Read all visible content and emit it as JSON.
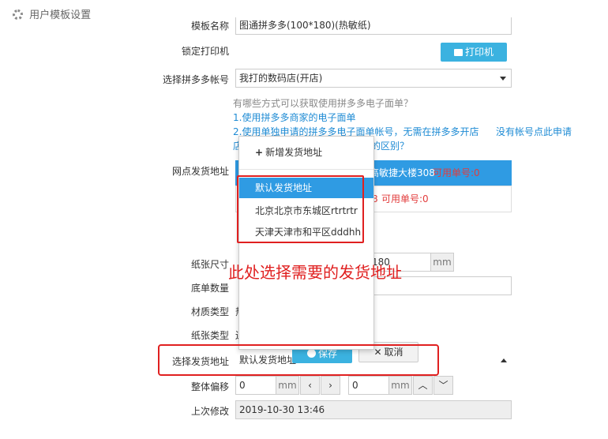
{
  "header": {
    "title": "用户模板设置"
  },
  "form": {
    "template_name_value": "图通拼多多(100*180)(热敏纸)",
    "lock_printer_label": "锁定打印机",
    "printer_button_label": "打印机",
    "pdd_account_label": "选择拼多多帐号",
    "pdd_account_value": "我打的数码店(开店)",
    "help_question": "有哪些方式可以获取使用拼多多电子面单？",
    "help_link1": "1.使用拼多多商家的电子面单",
    "help_link2": "2.使用单独申请的拼多多电子面单帐号，无需在拼多多开店",
    "help_link2_cont": "店",
    "help_link3": "没有帐号点此申请",
    "help_diff": "的区别？",
    "branch_address_label": "网点发货地址",
    "branch_row1_addr": "高敏捷大楼308",
    "branch_row1_avail": "可用单号:0",
    "branch_row2_addr": "8",
    "branch_row2_avail": "可用单号:0",
    "paper_size_label": "纸张尺寸",
    "paper_height_value": "180",
    "paper_unit": "mm",
    "base_count_label": "底单数量",
    "material_label": "材质类型",
    "material_value_fragment": "热",
    "paper_type_label": "纸张类型",
    "paper_type_fragment": "连",
    "ship_address_label": "选择发货地址",
    "ship_address_value": "默认发货地址",
    "save_button": "保存",
    "cancel_button": "取消",
    "offset_label": "整体偏移",
    "offset_x_value": "0",
    "offset_y_value": "0",
    "offset_unit": "mm",
    "last_modified_label": "上次修改",
    "last_modified_value": "2019-10-30 13:46"
  },
  "dropdown": {
    "add_label": "新增发货地址",
    "items": [
      "默认发货地址",
      "北京北京市东城区rtrtrtr",
      "天津天津市和平区dddhh"
    ]
  },
  "annotation": {
    "text": "此处选择需要的发货地址"
  },
  "colors": {
    "accent": "#1e8bd4",
    "highlight": "#2f9be3",
    "button": "#3bb2e0",
    "annotation_red": "#e02020"
  }
}
